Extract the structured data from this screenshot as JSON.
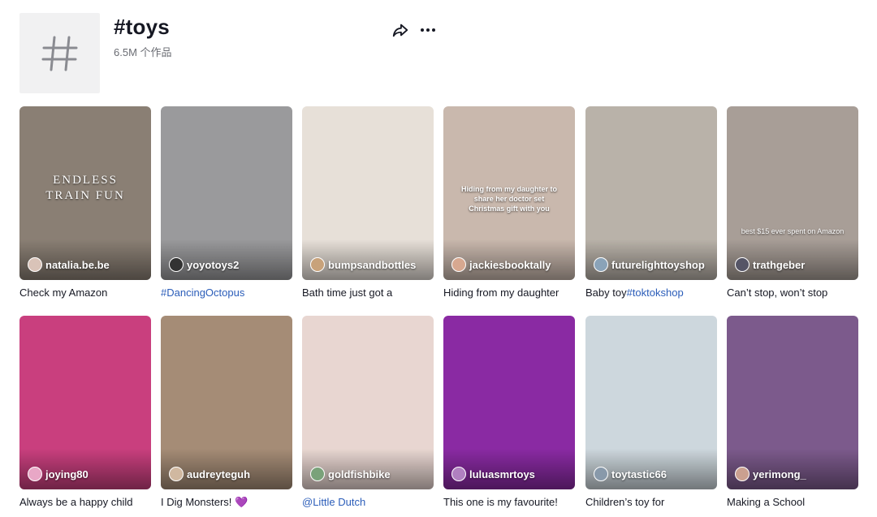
{
  "header": {
    "title": "#toys",
    "count": "6.5M 个作品"
  },
  "videos": [
    {
      "author": "natalia.be.be",
      "caption": "Check my Amazon",
      "overlay": "ENDLESS TRAIN FUN",
      "bg": "#8a7f74"
    },
    {
      "author": "yoyotoys2",
      "caption_tag": "#DancingOctopus",
      "bg": "#9a9a9c"
    },
    {
      "author": "bumpsandbottles",
      "caption": "Bath time just got a",
      "bg": "#e7e0d8"
    },
    {
      "author": "jackiesbooktally",
      "caption": "Hiding from my daughter",
      "overlay": "Hiding from my daughter to share her doctor set Christmas gift with you",
      "bg": "#c9b8ad"
    },
    {
      "author": "futurelighttoyshop",
      "caption": "Baby toy",
      "caption_tag": "#toktokshop",
      "bg": "#b9b2a9"
    },
    {
      "author": "trathgeber",
      "caption": "Can’t stop, won’t stop",
      "overlay": "best $15 ever spent on Amazon",
      "bg": "#a89e97"
    },
    {
      "author": "joying80",
      "caption": "Always be a happy child",
      "bg": "#c93f7e"
    },
    {
      "author": "audreyteguh",
      "caption": "I Dig Monsters! 💜",
      "bg": "#a58c76"
    },
    {
      "author": "goldfishbike",
      "caption_tag": "@Little Dutch",
      "bg": "#e8d6d1"
    },
    {
      "author": "luluasmrtoys",
      "caption": "This one is my favourite!",
      "bg": "#8a2aa3"
    },
    {
      "author": "toytastic66",
      "caption": "Children’s toy for",
      "bg": "#cdd7dd"
    },
    {
      "author": "yerimong_",
      "caption": "Making a School",
      "bg": "#7c5a8c"
    }
  ]
}
